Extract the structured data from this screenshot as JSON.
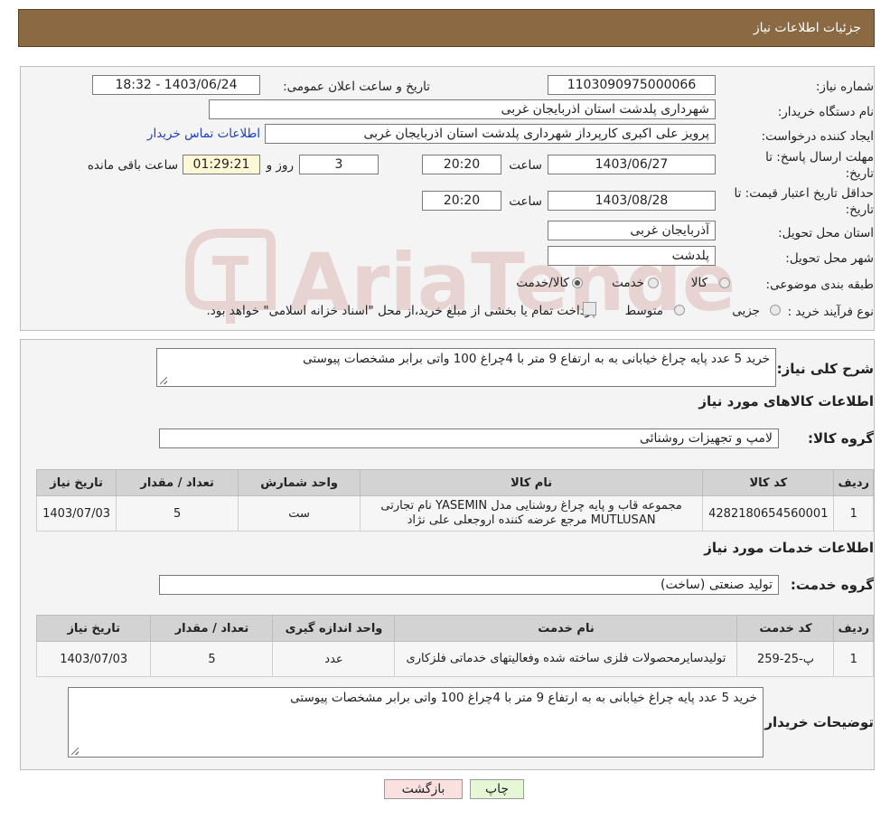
{
  "header": {
    "title": "جزئیات اطلاعات نیاز"
  },
  "watermark": {
    "text": "AriaTender.neT"
  },
  "form": {
    "need_number_label": "شماره نیاز:",
    "need_number": "1103090975000066",
    "announce_label": "تاریخ و ساعت اعلان عمومی:",
    "announce_value": "1403/06/24 - 18:32",
    "buyer_org_label": "نام دستگاه خریدار:",
    "buyer_org": "شهرداری پلدشت استان اذربایجان غربی",
    "creator_label": "ایجاد کننده درخواست:",
    "creator": "پرویز علی اکبری کارپرداز شهرداری پلدشت استان اذربایجان غربی",
    "contact_link": "اطلاعات تماس خریدار",
    "deadline_label_1": "مهلت ارسال پاسخ: تا",
    "deadline_label_2": "تاریخ:",
    "deadline_date": "1403/06/27",
    "time_label": "ساعت",
    "deadline_time": "20:20",
    "days_value": "3",
    "days_label": "روز و",
    "remaining_time": "01:29:21",
    "remaining_label": "ساعت باقی مانده",
    "validity_label_1": "حداقل تاریخ اعتبار قیمت: تا",
    "validity_label_2": "تاریخ:",
    "validity_date": "1403/08/28",
    "validity_time": "20:20",
    "province_label": "استان محل تحویل:",
    "province": "آذربایجان غربی",
    "city_label": "شهر محل تحویل:",
    "city": "پلدشت",
    "category_label": "طبقه بندی موضوعی:",
    "category_options": [
      "کالا",
      "خدمت",
      "کالا/خدمت"
    ],
    "category_selected": "کالا/خدمت",
    "process_label": "نوع فرآیند خرید :",
    "process_options": [
      "جزیی",
      "متوسط"
    ],
    "process_note": "پرداخت تمام یا بخشی از مبلغ خرید،از محل \"اسناد خزانه اسلامی\" خواهد بود."
  },
  "details": {
    "summary_label": "شرح کلی نیاز:",
    "summary": "خرید 5 عدد پایه چراغ خیابانی به به ارتفاع 9 متر با 4چراغ 100 واتی برابر مشخصات پیوستی",
    "goods_section_title": "اطلاعات کالاهای مورد نیاز",
    "goods_group_label": "گروه کالا:",
    "goods_group": "لامپ و تجهیزات روشنائی",
    "goods_table": {
      "headers": [
        "ردیف",
        "کد کالا",
        "نام کالا",
        "واحد شمارش",
        "تعداد / مقدار",
        "تاریخ نیاز"
      ],
      "rows": [
        [
          "1",
          "4282180654560001",
          "مجموعه قاب و پایه چراغ روشنایی مدل YASEMIN نام تجارتی MUTLUSAN مرجع عرضه کننده اروجعلی علی نژاد",
          "ست",
          "5",
          "1403/07/03"
        ]
      ]
    },
    "services_section_title": "اطلاعات خدمات مورد نیاز",
    "service_group_label": "گروه خدمت:",
    "service_group": "تولید صنعتی (ساخت)",
    "services_table": {
      "headers": [
        "ردیف",
        "کد خدمت",
        "نام خدمت",
        "واحد اندازه گیری",
        "تعداد / مقدار",
        "تاریخ نیاز"
      ],
      "rows": [
        [
          "1",
          "پ-25-259",
          "تولیدسایرمحصولات فلزی ساخته شده وفعالیتهای خدماتی فلزکاری",
          "عدد",
          "5",
          "1403/07/03"
        ]
      ]
    },
    "buyer_notes_label": "توضیحات خریدار:",
    "buyer_notes": "خرید 5 عدد پایه چراغ خیابانی به به ارتفاع 9 متر با 4چراغ 100 واتی برابر مشخصات پیوستی"
  },
  "buttons": {
    "print": "چاپ",
    "back": "بازگشت"
  },
  "colors": {
    "header_bg": "#8b6a43",
    "print_bg": "#e6f7d6",
    "back_bg": "#fbe0e0",
    "link": "#1a3fbf"
  }
}
